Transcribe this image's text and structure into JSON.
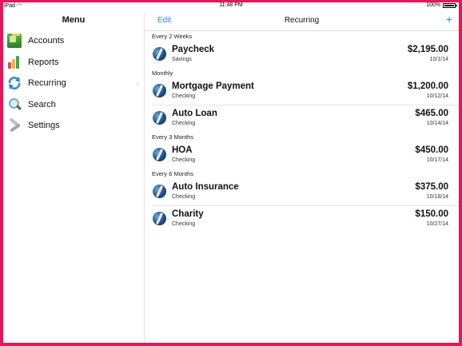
{
  "status_bar": {
    "carrier": "iPad",
    "wifi_icon": "wifi-icon",
    "time": "11:48 PM",
    "battery": "100%",
    "battery_level": 1.0
  },
  "sidebar": {
    "title": "Menu",
    "items": [
      {
        "label": "Accounts",
        "icon": "accounts-icon"
      },
      {
        "label": "Reports",
        "icon": "reports-icon"
      },
      {
        "label": "Recurring",
        "icon": "recurring-icon",
        "selected": true
      },
      {
        "label": "Search",
        "icon": "search-icon"
      },
      {
        "label": "Settings",
        "icon": "settings-icon"
      }
    ]
  },
  "main": {
    "edit_label": "Edit",
    "title": "Recurring",
    "add_label": "+",
    "sections": [
      {
        "header": "Every 2 Weeks",
        "rows": [
          {
            "name": "Paycheck",
            "account": "Savings",
            "amount": "$2,195.00",
            "date": "10/1/14"
          }
        ]
      },
      {
        "header": "Monthly",
        "rows": [
          {
            "name": "Mortgage Payment",
            "account": "Checking",
            "amount": "$1,200.00",
            "date": "10/12/14"
          },
          {
            "name": "Auto Loan",
            "account": "Checking",
            "amount": "$465.00",
            "date": "10/14/14"
          }
        ]
      },
      {
        "header": "Every 3 Months",
        "rows": [
          {
            "name": "HOA",
            "account": "Checking",
            "amount": "$450.00",
            "date": "10/17/14"
          }
        ]
      },
      {
        "header": "Every 6 Months",
        "rows": [
          {
            "name": "Auto Insurance",
            "account": "Checking",
            "amount": "$375.00",
            "date": "10/18/14"
          },
          {
            "name": "Charity",
            "account": "Checking",
            "amount": "$150.00",
            "date": "10/27/14"
          }
        ]
      }
    ]
  },
  "colors": {
    "accent": "#1c8cf0",
    "border_frame": "#e8155a"
  }
}
